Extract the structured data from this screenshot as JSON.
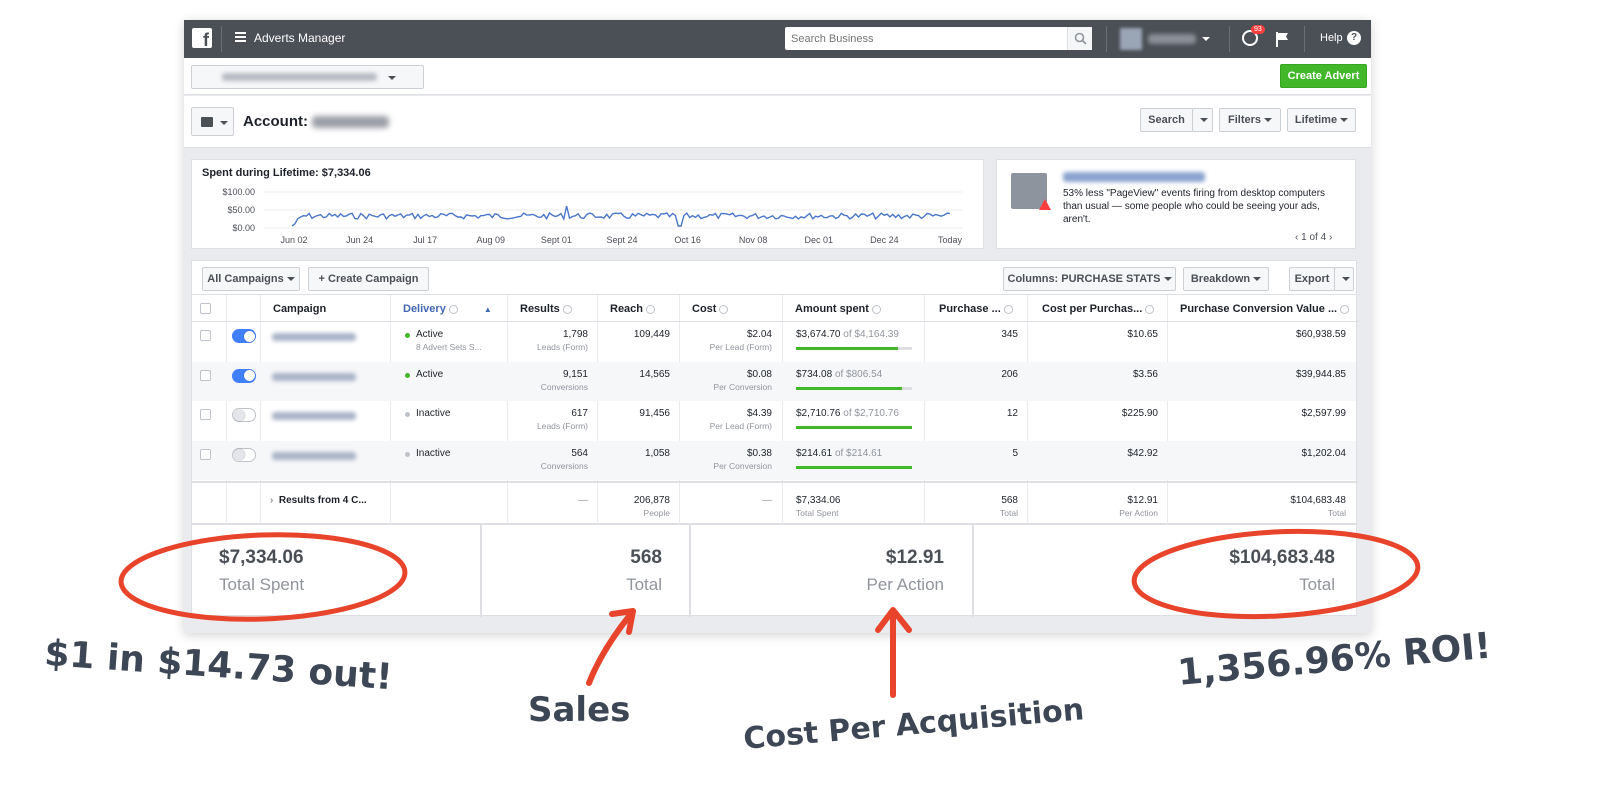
{
  "topbar": {
    "app_title": "Adverts Manager",
    "search_placeholder": "Search Business",
    "notification_count": "93",
    "help_label": "Help"
  },
  "create_advert_label": "Create Advert",
  "account": {
    "label": "Account:",
    "search_label": "Search",
    "filters_label": "Filters",
    "lifetime_label": "Lifetime"
  },
  "chart": {
    "title": "Spent during Lifetime: $7,334.06",
    "y_ticks": [
      "$100.00",
      "$50.00",
      "$0.00"
    ],
    "x_ticks": [
      "Jun 02",
      "Jun 24",
      "Jul 17",
      "Aug 09",
      "Sept 01",
      "Sept 24",
      "Oct 16",
      "Nov 08",
      "Dec 01",
      "Dec 24",
      "Today"
    ],
    "line_color": "#4a76c9"
  },
  "pixel_notice": {
    "text": "53% less \"PageView\" events firing from desktop computers than usual — some people who could be seeing your ads, aren't.",
    "pager": "1 of 4"
  },
  "toolbar": {
    "all_campaigns": "All Campaigns",
    "create_campaign": "Create Campaign",
    "columns_label": "Columns: PURCHASE STATS",
    "breakdown_label": "Breakdown",
    "export_label": "Export"
  },
  "table": {
    "headers": {
      "campaign": "Campaign",
      "delivery": "Delivery",
      "results": "Results",
      "reach": "Reach",
      "cost": "Cost",
      "amount_spent": "Amount spent",
      "purchases": "Purchase ...",
      "cost_per_purchase": "Cost per Purchas...",
      "conversion_value": "Purchase Conversion Value ..."
    },
    "rows": [
      {
        "status": "Active",
        "status_sub": "8 Advert Sets S...",
        "results": "1,798",
        "results_sub": "Leads (Form)",
        "reach": "109,449",
        "cost": "$2.04",
        "cost_sub": "Per Lead (Form)",
        "spent": "$3,674.70",
        "budget": "of $4,164.39",
        "progress": 0.88,
        "purchases": "345",
        "cpp": "$10.65",
        "value": "$60,938.59",
        "toggle": "on"
      },
      {
        "status": "Active",
        "status_sub": "",
        "results": "9,151",
        "results_sub": "Conversions",
        "reach": "14,565",
        "cost": "$0.08",
        "cost_sub": "Per Conversion",
        "spent": "$734.08",
        "budget": "of $806.54",
        "progress": 0.91,
        "purchases": "206",
        "cpp": "$3.56",
        "value": "$39,944.85",
        "toggle": "on"
      },
      {
        "status": "Inactive",
        "status_sub": "",
        "results": "617",
        "results_sub": "Leads (Form)",
        "reach": "91,456",
        "cost": "$4.39",
        "cost_sub": "Per Lead (Form)",
        "spent": "$2,710.76",
        "budget": "of $2,710.76",
        "progress": 1.0,
        "purchases": "12",
        "cpp": "$225.90",
        "value": "$2,597.99",
        "toggle": "off"
      },
      {
        "status": "Inactive",
        "status_sub": "",
        "results": "564",
        "results_sub": "Conversions",
        "reach": "1,058",
        "cost": "$0.38",
        "cost_sub": "Per Conversion",
        "spent": "$214.61",
        "budget": "of $214.61",
        "progress": 1.0,
        "purchases": "5",
        "cpp": "$42.92",
        "value": "$1,202.04",
        "toggle": "off"
      }
    ],
    "totals": {
      "label": "Results from 4 C...",
      "results": "—",
      "reach": "206,878",
      "reach_sub": "People",
      "cost": "—",
      "spent": "$7,334.06",
      "spent_sub": "Total Spent",
      "purchases": "568",
      "purchases_sub": "Total",
      "cpp": "$12.91",
      "cpp_sub": "Per Action",
      "value": "$104,683.48",
      "value_sub": "Total"
    }
  },
  "summary": {
    "spent": "$7,334.06",
    "spent_label": "Total Spent",
    "sales": "568",
    "sales_label": "Total",
    "cpa": "$12.91",
    "cpa_label": "Per Action",
    "value": "$104,683.48",
    "value_label": "Total"
  },
  "annotations": {
    "roi_ratio": "$1 in $14.73 out!",
    "sales": "Sales",
    "cpa": "Cost Per Acquisition",
    "roi": "1,356.96% ROI!",
    "accent": "#e8432b"
  }
}
